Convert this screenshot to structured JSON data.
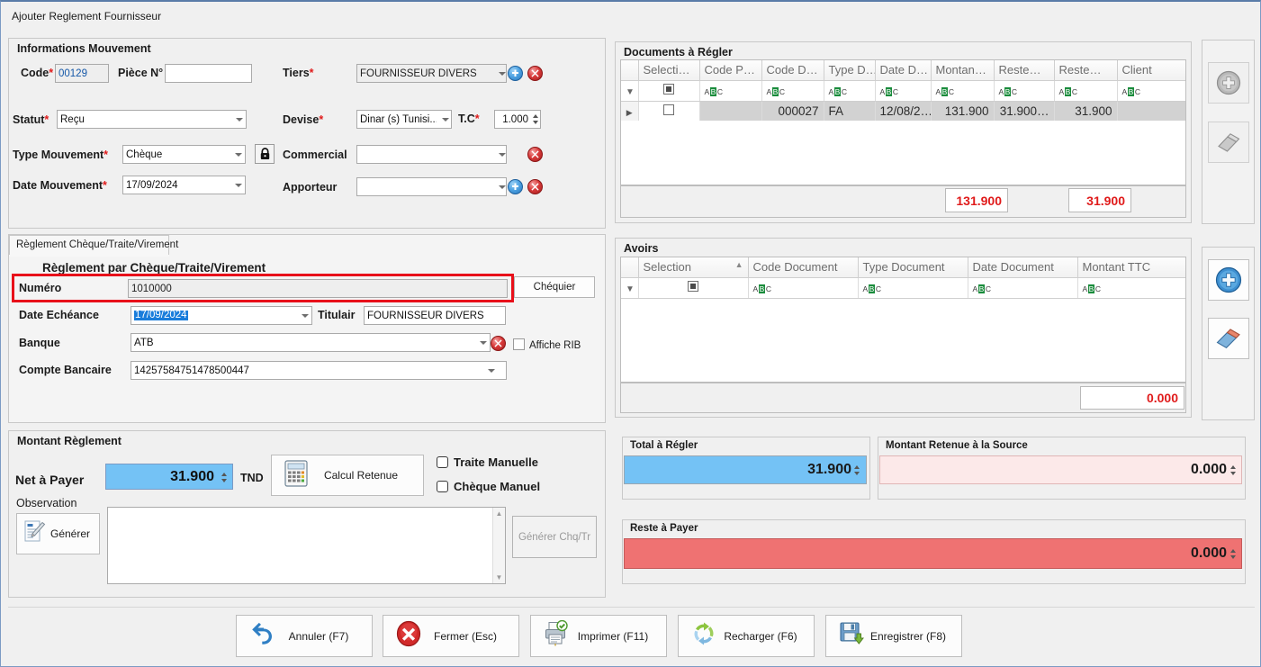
{
  "window": {
    "title": "Ajouter Reglement Fournisseur"
  },
  "informations_mouvement": {
    "title": "Informations Mouvement",
    "code_label": "Code",
    "code_value": "00129",
    "piece_label": "Pièce N°",
    "piece_value": "",
    "tiers_label": "Tiers",
    "tiers_value": "FOURNISSEUR DIVERS",
    "statut_label": "Statut",
    "statut_value": "Reçu",
    "devise_label": "Devise",
    "devise_value": "Dinar (s) Tunisi...",
    "tc_label": "T.C",
    "tc_value": "1.000",
    "type_mouvement_label": "Type Mouvement",
    "type_mouvement_value": "Chèque",
    "commercial_label": "Commercial",
    "commercial_value": "",
    "date_mouvement_label": "Date Mouvement",
    "date_mouvement_value": "17/09/2024",
    "apporteur_label": "Apporteur",
    "apporteur_value": "",
    "required_marker": "*"
  },
  "reglement": {
    "tab_label": "Règlement Chèque/Traite/Virement",
    "section_title": "Règlement par Chèque/Traite/Virement",
    "numero_label": "Numéro",
    "numero_value": "1010000",
    "chequier_button": "Chéquier",
    "date_echeance_label": "Date Echéance",
    "date_echeance_value": "17/09/2024",
    "titulair_label": "Titulair",
    "titulair_value": "FOURNISSEUR DIVERS",
    "banque_label": "Banque",
    "banque_value": "ATB",
    "affiche_rib_label": "Affiche RIB",
    "affiche_rib_checked": false,
    "compte_bancaire_label": "Compte Bancaire",
    "compte_bancaire_value": "14257584751478500447",
    "highlight_color": "#e8101a"
  },
  "montant_reglement": {
    "title": "Montant Règlement",
    "net_a_payer_label": "Net à Payer",
    "net_a_payer_value": "31.900",
    "currency": "TND",
    "calcul_retenue_button": "Calcul Retenue",
    "traite_manuelle_label": "Traite Manuelle",
    "traite_manuelle_checked": false,
    "cheque_manuel_label": "Chèque Manuel",
    "cheque_manuel_checked": false,
    "observation_label": "Observation",
    "observation_value": "",
    "generer_button": "Générer",
    "generer_chq_tr_button": "Générer Chq/Tr"
  },
  "documents_a_regler": {
    "title": "Documents à Régler",
    "columns": [
      "Selecti…",
      "Code P…",
      "Code D…",
      "Type D…",
      "Date D…",
      "Montan…",
      "Reste…",
      "Reste…",
      "Client"
    ],
    "filter_glyph": "ABC",
    "rows": [
      {
        "selection": false,
        "code_p": "",
        "code_d": "000027",
        "type_d": "FA",
        "date_d": "12/08/2…",
        "montant": "131.900",
        "reste1": "31.900…",
        "reste2": "31.900",
        "client": ""
      }
    ],
    "footer_total_montant": "131.900",
    "footer_total_reste": "31.900"
  },
  "avoirs": {
    "title": "Avoirs",
    "columns": [
      "Selection",
      "Code Document",
      "Type Document",
      "Date Document",
      "Montant TTC"
    ],
    "filter_glyph": "ABC",
    "rows": [],
    "footer_total": "0.000"
  },
  "totals": {
    "total_a_regler_label": "Total à Régler",
    "total_a_regler_value": "31.900",
    "total_a_regler_color": "#74c2f5",
    "montant_retenue_label": "Montant Retenue à la Source",
    "montant_retenue_value": "0.000",
    "montant_retenue_color": "#fce9e9",
    "reste_a_payer_label": "Reste à Payer",
    "reste_a_payer_value": "0.000",
    "reste_a_payer_color": "#ef7272"
  },
  "side_buttons": {
    "documents_add": "add-icon",
    "documents_erase": "eraser-icon",
    "avoirs_add": "add-icon",
    "avoirs_erase": "eraser-icon"
  },
  "toolbar": {
    "annuler": "Annuler (F7)",
    "fermer": "Fermer (Esc)",
    "imprimer": "Imprimer (F11)",
    "recharger": "Recharger (F6)",
    "enregistrer": "Enregistrer (F8)"
  }
}
